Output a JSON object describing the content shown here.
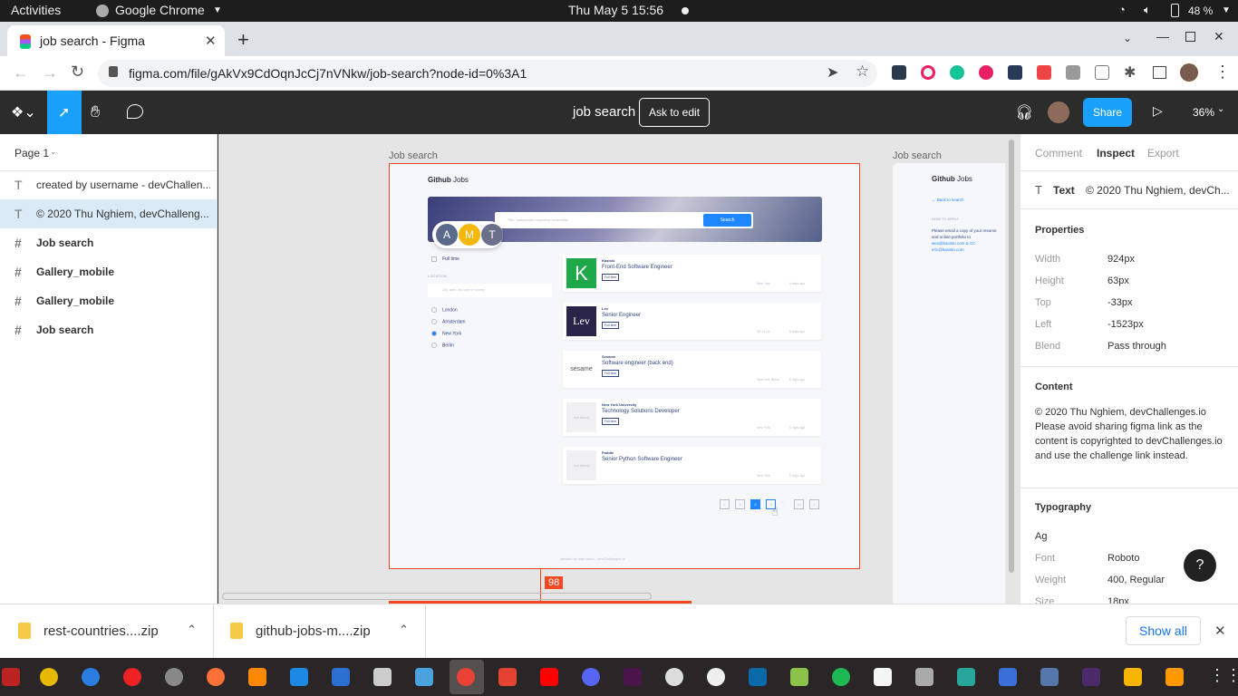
{
  "system": {
    "activities": "Activities",
    "app": "Google Chrome",
    "clock": "Thu May 5  15:56",
    "battery": "48 %"
  },
  "browser": {
    "tab_title": "job search - Figma",
    "url": "figma.com/file/gAkVx9CdOqnJcCj7nVNkw/job-search?node-id=0%3A1"
  },
  "figma": {
    "file_title": "job search",
    "ask_to_edit": "Ask to edit",
    "share": "Share",
    "zoom": "36%",
    "page_name": "Page 1",
    "layers": [
      {
        "icon": "T",
        "label": "created by username - devChallen..."
      },
      {
        "icon": "T",
        "label": "© 2020 Thu Nghiem, devChalleng..."
      },
      {
        "icon": "#",
        "label": "Job search"
      },
      {
        "icon": "#",
        "label": "Gallery_mobile"
      },
      {
        "icon": "#",
        "label": "Gallery_mobile"
      },
      {
        "icon": "#",
        "label": "Job search"
      }
    ],
    "frame_label_1": "Job search",
    "frame_label_2": "Job search",
    "measure": "98",
    "avatars": [
      "A",
      "M",
      "T"
    ],
    "help": "?"
  },
  "design": {
    "brand_bold": "Github",
    "brand_light": "Jobs",
    "search_placeholder": "Title, companies, expertise or benefits",
    "search_button": "Search",
    "full_time": "Full time",
    "location_label": "LOCATION",
    "location_placeholder": "City, state, zip code or country",
    "cities": [
      "London",
      "Amsterdam",
      "New York",
      "Berlin"
    ],
    "jobs": [
      {
        "company": "Kasisto",
        "title": "Front-End Software Engineer",
        "type": "Full time",
        "location": "New York",
        "age": "5 days ago",
        "logo_text": "K"
      },
      {
        "company": "Lev",
        "title": "Senior Engineer",
        "type": "Full time",
        "location": "NY or LA",
        "age": "5 days ago",
        "logo_text": "Lev"
      },
      {
        "company": "Sesame",
        "title": "Software engineer (back end)",
        "type": "Full time",
        "location": "New York Berlin",
        "age": "5 days ago",
        "logo_text": "sesame"
      },
      {
        "company": "New York University",
        "title": "Technology Solutions Developer",
        "type": "Full time",
        "location": "New York",
        "age": "5 days ago",
        "logo_text": "not found"
      },
      {
        "company": "Paddle",
        "title": "Senior Python Software Engineer",
        "type": "",
        "location": "New York",
        "age": "5 days ago",
        "logo_text": "not found"
      }
    ],
    "pages": [
      "<",
      "1",
      "2",
      "3",
      "...",
      "10",
      ">"
    ],
    "footer": "created by username - devChallenges.io",
    "mobile_brand_bold": "Github",
    "mobile_brand_light": "Jobs",
    "back": "Back to search",
    "how_to_apply": "HOW TO APPLY",
    "apply_text": "Please email a copy of your resume and online portfolio to",
    "apply_email": "wes@kasisto.com & CC eric@kasisto.com"
  },
  "inspect": {
    "tabs": [
      "Comment",
      "Inspect",
      "Export"
    ],
    "active_tab": "Inspect",
    "node_type": "Text",
    "node_name": "© 2020 Thu Nghiem, devCh...",
    "properties_title": "Properties",
    "props": [
      {
        "k": "Width",
        "v": "924px"
      },
      {
        "k": "Height",
        "v": "63px"
      },
      {
        "k": "Top",
        "v": "-33px"
      },
      {
        "k": "Left",
        "v": "-1523px"
      },
      {
        "k": "Blend",
        "v": "Pass through"
      }
    ],
    "content_title": "Content",
    "content": "© 2020 Thu Nghiem, devChallenges.io Please avoid sharing figma link as the content is copyrighted to devChallenges.io and use the challenge link instead.",
    "typography_title": "Typography",
    "ag": "Ag",
    "typo": [
      {
        "k": "Font",
        "v": "Roboto"
      },
      {
        "k": "Weight",
        "v": "400, Regular"
      },
      {
        "k": "Size",
        "v": "18px"
      }
    ]
  },
  "downloads": {
    "items": [
      "rest-countries....zip",
      "github-jobs-m....zip"
    ],
    "show_all": "Show all"
  },
  "colors": {
    "figma_blue": "#18a0fb",
    "selection_red": "#f24822",
    "design_blue": "#1e86ff"
  }
}
